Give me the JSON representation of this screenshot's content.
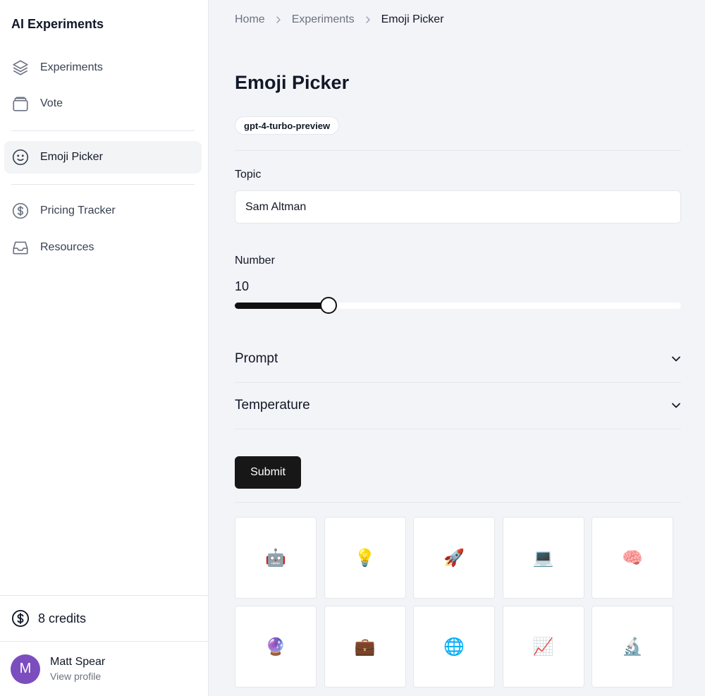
{
  "app": {
    "title": "AI Experiments"
  },
  "sidebar": {
    "items": [
      {
        "label": "Experiments",
        "icon": "layers-icon"
      },
      {
        "label": "Vote",
        "icon": "box-icon"
      },
      {
        "label": "Emoji Picker",
        "icon": "smile-icon",
        "active": true
      },
      {
        "label": "Pricing Tracker",
        "icon": "dollar-circle-icon"
      },
      {
        "label": "Resources",
        "icon": "inbox-icon"
      }
    ],
    "credits": {
      "label": "8 credits",
      "icon": "dollar-circle-icon"
    },
    "profile": {
      "initial": "M",
      "name": "Matt Spear",
      "link": "View profile",
      "avatar_color": "#7c4dbf"
    }
  },
  "breadcrumb": {
    "items": [
      "Home",
      "Experiments"
    ],
    "current": "Emoji Picker"
  },
  "main": {
    "title": "Emoji Picker",
    "model_badge": "gpt-4-turbo-preview",
    "topic": {
      "label": "Topic",
      "value": "Sam Altman"
    },
    "number": {
      "label": "Number",
      "value": "10",
      "fraction": 0.21
    },
    "accordions": [
      {
        "label": "Prompt",
        "icon": "chevron-down-icon"
      },
      {
        "label": "Temperature",
        "icon": "chevron-down-icon"
      }
    ],
    "submit_label": "Submit",
    "emojis": [
      "🤖",
      "💡",
      "🚀",
      "💻",
      "🧠",
      "🔮",
      "💼",
      "🌐",
      "📈",
      "🔬"
    ]
  },
  "colors": {
    "accent": "#171717",
    "background": "#f3f4f8",
    "sidebar": "#ffffff",
    "border": "#e5e7eb"
  }
}
